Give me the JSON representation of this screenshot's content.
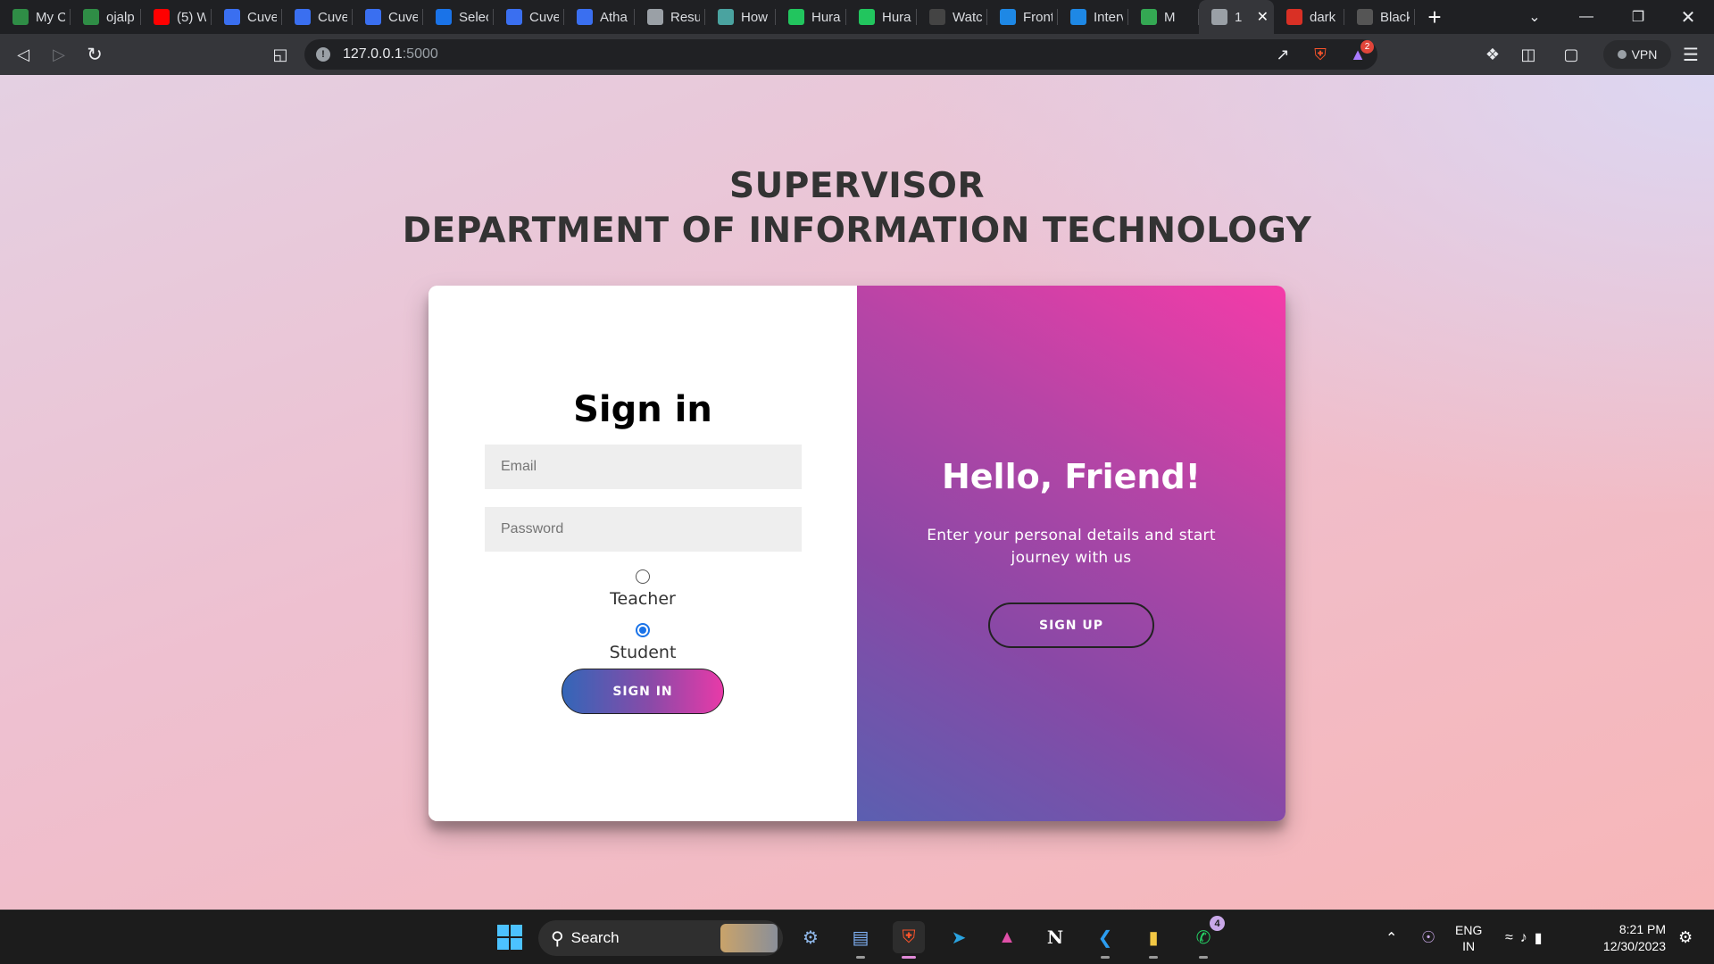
{
  "browser": {
    "tabs": [
      {
        "title": "My C",
        "icon": "geeksforgeeks-icon",
        "color": "#2f8d46"
      },
      {
        "title": "ojalp",
        "icon": "geeksforgeeks-icon",
        "color": "#2f8d46"
      },
      {
        "title": "(5) W",
        "icon": "youtube-icon",
        "color": "#ff0000"
      },
      {
        "title": "Cuve",
        "icon": "cuvette-icon",
        "color": "#3a6ff0"
      },
      {
        "title": "Cuve",
        "icon": "cuvette-icon",
        "color": "#3a6ff0"
      },
      {
        "title": "Cuve",
        "icon": "cuvette-icon",
        "color": "#3a6ff0"
      },
      {
        "title": "Selec",
        "icon": "chrome-c-icon",
        "color": "#1a73e8"
      },
      {
        "title": "Cuve",
        "icon": "cuvette-icon",
        "color": "#3a6ff0"
      },
      {
        "title": "Atha",
        "icon": "cuvette-icon",
        "color": "#3a6ff0"
      },
      {
        "title": "Resu",
        "icon": "globe-icon",
        "color": "#9aa0a6"
      },
      {
        "title": "How",
        "icon": "k-icon",
        "color": "#4aa3a0"
      },
      {
        "title": "Hura",
        "icon": "huramat-icon",
        "color": "#22c55e"
      },
      {
        "title": "Hura",
        "icon": "huramat-icon",
        "color": "#22c55e"
      },
      {
        "title": "Watc",
        "icon": "w-icon",
        "color": "#444444"
      },
      {
        "title": "Front",
        "icon": "is-icon",
        "color": "#1e88e5"
      },
      {
        "title": "Interv",
        "icon": "is-icon",
        "color": "#1e88e5"
      },
      {
        "title": "M",
        "icon": "meet-icon",
        "color": "#34a853"
      },
      {
        "title": "1",
        "icon": "globe-icon",
        "color": "#9aa0a6",
        "active": true
      },
      {
        "title": "dark",
        "icon": "shield-icon",
        "color": "#d93025"
      },
      {
        "title": "Black",
        "icon": "sparkle-icon",
        "color": "#555555"
      }
    ],
    "url_host": "127.0.0.1",
    "url_port": ":5000",
    "vpn_label": "VPN",
    "brave_rewards_count": "2"
  },
  "page": {
    "heading_line1": "SUPERVISOR",
    "heading_line2": "DEPARTMENT OF INFORMATION TECHNOLOGY",
    "signin": {
      "title": "Sign in",
      "email_placeholder": "Email",
      "password_placeholder": "Password",
      "role_teacher": "Teacher",
      "role_student": "Student",
      "selected_role": "Student",
      "button": "SIGN IN"
    },
    "overlay": {
      "title": "Hello, Friend!",
      "text": "Enter your personal details and start journey with us",
      "button": "SIGN UP"
    }
  },
  "taskbar": {
    "search_label": "Search",
    "whatsapp_badge": "4",
    "lang_line1": "ENG",
    "lang_line2": "IN",
    "time": "8:21 PM",
    "date": "12/30/2023"
  }
}
